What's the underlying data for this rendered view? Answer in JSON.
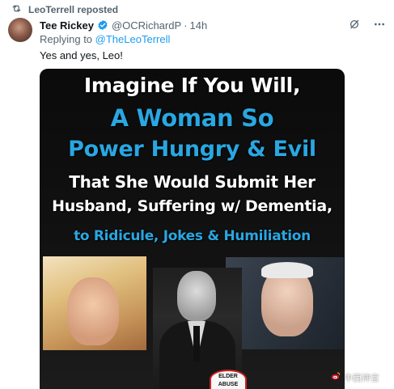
{
  "repost": {
    "text": "LeoTerrell reposted",
    "icon": "repost-icon"
  },
  "tweet": {
    "author_name": "Tee Rickey",
    "author_handle": "@OCRichardP",
    "separator": "·",
    "time": "14h",
    "replying_prefix": "Replying to",
    "replying_to": "@TheLeoTerrell",
    "text": "Yes and yes, Leo!"
  },
  "media": {
    "lines": [
      "Imagine If You Will,",
      "A Woman So",
      "Power Hungry & Evil",
      "That She Would Submit Her",
      "Husband, Suffering w/ Dementia,",
      "to Ridicule, Jokes & Humiliation"
    ],
    "sticker_top": "ELDER",
    "sticker_bottom": "ABUSE",
    "watermark": "中西神言"
  },
  "colors": {
    "accent_blue": "#1d9bf0",
    "meme_blue": "#29a7e1",
    "secondary_text": "#536471"
  }
}
